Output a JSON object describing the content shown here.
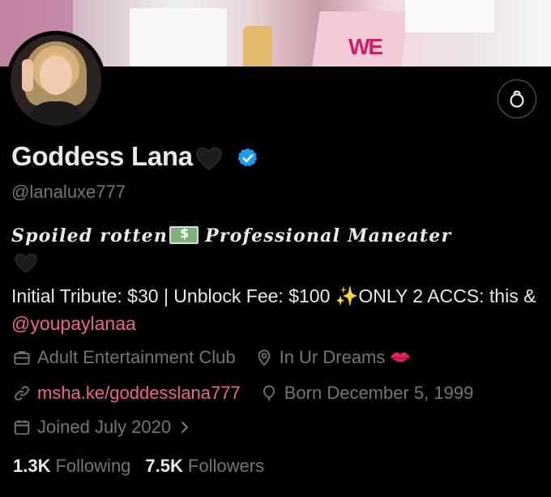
{
  "profile": {
    "display_name": "Goddess Lana",
    "handle": "@lanaluxe777",
    "bio_line1": "Spoiled rotten",
    "bio_line1b": "Professional Maneater",
    "bio_line2a": "Initial Tribute: $30 | Unblock Fee: $100 ",
    "bio_sparkle": "✨",
    "bio_line2b": "ONLY 2 ACCS: this & ",
    "bio_mention": "@youpaylanaa",
    "category": "Adult Entertainment Club",
    "location": "In Ur Dreams",
    "website": "msha.ke/goddesslana777",
    "birthday": "Born December 5, 1999",
    "joined": "Joined July 2020",
    "following_count": "1.3K",
    "following_label": "Following",
    "followers_count": "7.5K",
    "followers_label": "Followers"
  },
  "banner": {
    "logo_text": "WE"
  },
  "colors": {
    "accent_link": "#f06292",
    "verified": "#1d9bf0",
    "muted": "#71767b",
    "text": "#e7e9ea"
  },
  "icons": [
    "more-icon",
    "verified-badge-icon",
    "briefcase-icon",
    "location-pin-icon",
    "link-icon",
    "balloon-icon",
    "calendar-icon",
    "chevron-right-icon",
    "black-heart-icon",
    "kiss-icon",
    "money-icon",
    "sparkles-icon"
  ]
}
